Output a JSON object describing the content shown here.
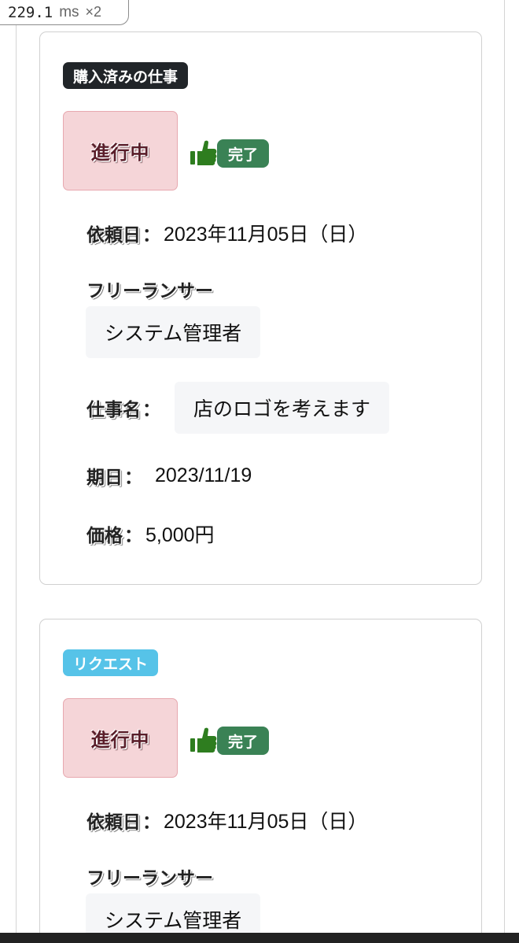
{
  "perf": {
    "value": "229.1",
    "unit": "ms",
    "multiplier": "×2"
  },
  "cards": [
    {
      "type_label": "購入済みの仕事",
      "type_style": "dark",
      "status": "進行中",
      "done_label": "完了",
      "request_date_label": "依頼日",
      "request_date": "2023年11月05日（日）",
      "freelancer_label": "フリーランサー",
      "freelancer_name": "システム管理者",
      "job_name_label": "仕事名",
      "job_name": "店のロゴを考えます",
      "due_date_label": "期日",
      "due_date": "2023/11/19",
      "price_label": "価格",
      "price": "5,000円"
    },
    {
      "type_label": "リクエスト",
      "type_style": "info",
      "status": "進行中",
      "done_label": "完了",
      "request_date_label": "依頼日",
      "request_date": "2023年11月05日（日）",
      "freelancer_label": "フリーランサー",
      "freelancer_name": "システム管理者"
    }
  ],
  "symbols": {
    "colon": "："
  },
  "colors": {
    "badge_dark": "#212529",
    "badge_info": "#56c3e8",
    "status_bg": "#f5d5d8",
    "done_green": "#3a8255",
    "thumb_green": "#2e7d1f"
  },
  "icons": {
    "done": "thumbs-up-icon"
  }
}
